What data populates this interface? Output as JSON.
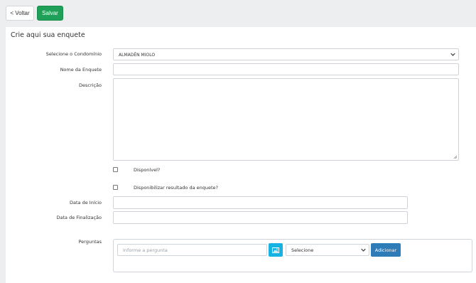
{
  "toolbar": {
    "back_label": "< Voltar",
    "save_label": "Salvar"
  },
  "panel": {
    "title": "Crie aqui sua enquete"
  },
  "form": {
    "condominio": {
      "label": "Selecione o Condomínio",
      "value": "ALMADÊN MIOLO"
    },
    "nome": {
      "label": "Nome da Enquete",
      "value": ""
    },
    "descricao": {
      "label": "Descrição",
      "value": ""
    },
    "disponivel": {
      "label": "Disponível?",
      "checked": false
    },
    "disponibilizar": {
      "label": "Disponibilizar resultado da enquete?",
      "checked": false
    },
    "data_inicio": {
      "label": "Data de Início",
      "value": ""
    },
    "data_fim": {
      "label": "Data de Finalização",
      "value": ""
    },
    "perguntas": {
      "label": "Perguntas",
      "input_placeholder": "Informe a pergunta",
      "select_value": "Selecione",
      "add_label": "Adicionar"
    }
  },
  "colors": {
    "save": "#1fa058",
    "image_button": "#17b4e3",
    "add_button": "#2d7cb8"
  },
  "icons": {
    "image_button": "image-icon",
    "select_chevron": "chevron-down-icon"
  }
}
